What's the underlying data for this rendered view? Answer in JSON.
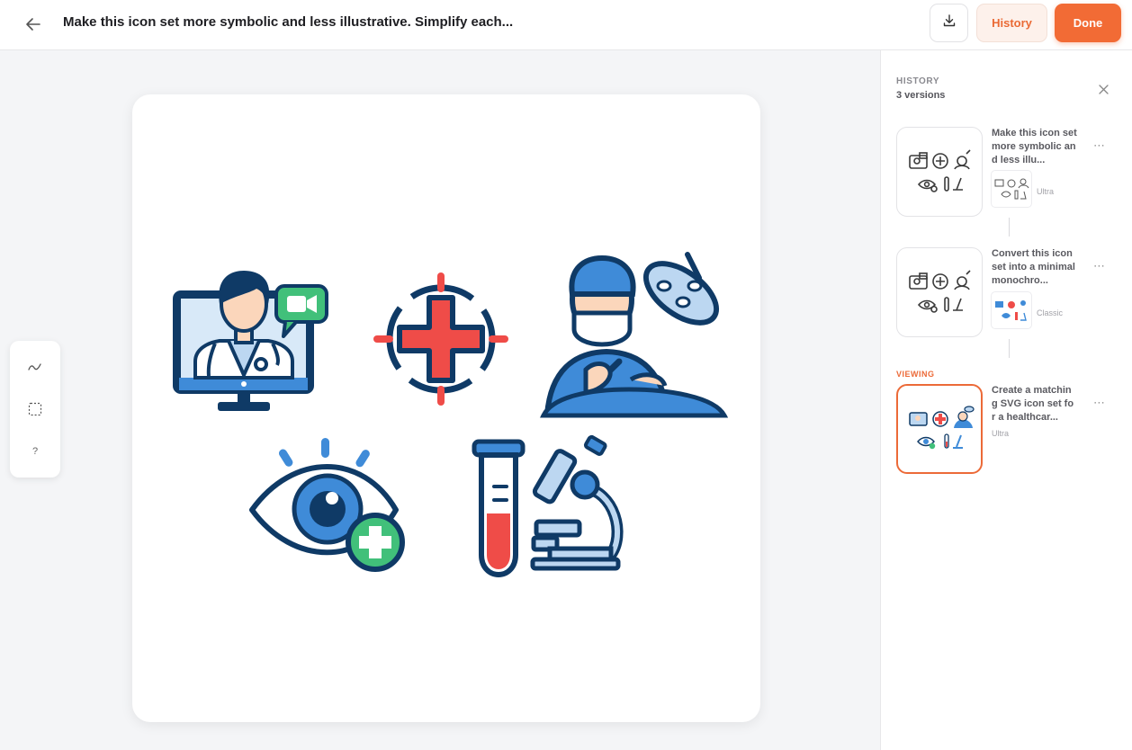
{
  "header": {
    "title": "Make this icon set more symbolic and less illustrative. Simplify each...",
    "history_button": "History",
    "done_button": "Done"
  },
  "tools": {
    "help_label": "?"
  },
  "history_panel": {
    "title": "HISTORY",
    "subtitle": "3 versions",
    "viewing_label": "VIEWING",
    "versions": [
      {
        "prompt": "Make this icon set more symbolic and less illu...",
        "tier": "Ultra",
        "state": "previous"
      },
      {
        "prompt": "Convert this icon set into a minimal monochro...",
        "tier": "Classic",
        "state": "previous"
      },
      {
        "prompt": "Create a matching SVG icon set for a healthcar...",
        "tier": "Ultra",
        "state": "viewing"
      }
    ]
  },
  "colors": {
    "accent": "#f26b35",
    "icon_navy": "#0f3a66",
    "icon_blue": "#3f8bd8",
    "icon_light_blue": "#bcd7f1",
    "icon_red": "#ef4c48",
    "icon_green": "#41c07a",
    "icon_skin": "#fbd6bb"
  },
  "icons": [
    "telemedicine-doctor-icon",
    "medical-cross-target-icon",
    "surgeon-operating-icon",
    "eye-care-plus-icon",
    "test-tube-microscope-icon"
  ]
}
